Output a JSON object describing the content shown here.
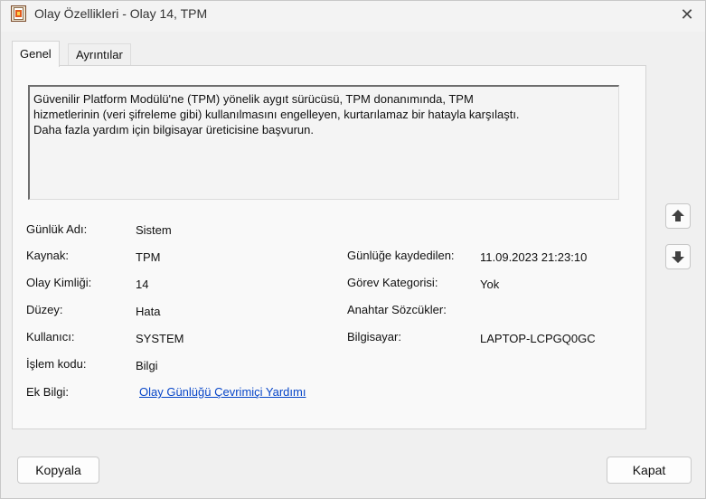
{
  "window": {
    "title": "Olay Özellikleri - Olay 14, TPM",
    "close_glyph": "✕"
  },
  "tabs": [
    {
      "label": "Genel",
      "active": true
    },
    {
      "label": "Ayrıntılar",
      "active": false
    }
  ],
  "description": "Güvenilir Platform Modülü'ne (TPM) yönelik aygıt sürücüsü, TPM donanımında, TPM\nhizmetlerinin (veri şifreleme gibi) kullanılmasını engelleyen, kurtarılamaz bir hatayla karşılaştı.\nDaha fazla yardım için bilgisayar üreticisine başvurun.",
  "fields": {
    "log_name": {
      "label": "Günlük Adı:",
      "value": "Sistem"
    },
    "source": {
      "label": "Kaynak:",
      "value": "TPM"
    },
    "event_id": {
      "label": "Olay Kimliği:",
      "value": "14"
    },
    "level": {
      "label": "Düzey:",
      "value": "Hata"
    },
    "user": {
      "label": "Kullanıcı:",
      "value": "SYSTEM"
    },
    "opcode": {
      "label": "İşlem kodu:",
      "value": "Bilgi"
    },
    "more_info": {
      "label": "Ek Bilgi:",
      "link": "Olay Günlüğü Çevrimiçi Yardımı"
    },
    "logged": {
      "label": "Günlüğe kaydedilen:",
      "value": "11.09.2023 21:23:10"
    },
    "task_category": {
      "label": "Görev Kategorisi:",
      "value": "Yok"
    },
    "keywords": {
      "label": "Anahtar Sözcükler:",
      "value": ""
    },
    "computer": {
      "label": "Bilgisayar:",
      "value": "LAPTOP-LCPGQ0GC"
    }
  },
  "buttons": {
    "copy": "Kopyala",
    "close": "Kapat"
  },
  "colors": {
    "link": "#0645c8",
    "arrow": "#404040"
  }
}
